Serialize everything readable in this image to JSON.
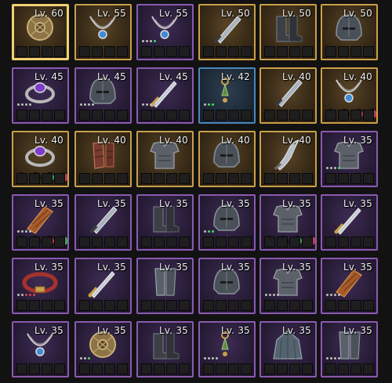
{
  "inventory": {
    "items": [
      {
        "icon": "shield-icon",
        "level": "Lv. 60",
        "rarity": "legendary",
        "selected": true,
        "dots": [],
        "gems": []
      },
      {
        "icon": "necklace-icon",
        "level": "Lv. 55",
        "rarity": "legendary",
        "dots": [],
        "gems": []
      },
      {
        "icon": "necklace-icon",
        "level": "Lv. 55",
        "rarity": "epic",
        "dots": [
          "white",
          "white",
          "white",
          "green"
        ],
        "gems": []
      },
      {
        "icon": "dagger-icon",
        "level": "Lv. 50",
        "rarity": "legendary",
        "dots": [],
        "gems": []
      },
      {
        "icon": "boots-icon",
        "level": "Lv. 50",
        "rarity": "legendary",
        "dots": [],
        "gems": []
      },
      {
        "icon": "helmet-icon",
        "level": "Lv. 50",
        "rarity": "legendary",
        "dots": [],
        "gems": []
      },
      {
        "icon": "ring-icon",
        "level": "Lv. 45",
        "rarity": "epic",
        "dots": [
          "white",
          "white",
          "white",
          "white"
        ],
        "gems": []
      },
      {
        "icon": "helmet-icon",
        "level": "Lv. 45",
        "rarity": "epic",
        "dots": [
          "white",
          "white",
          "white",
          "white"
        ],
        "gems": []
      },
      {
        "icon": "sword-icon",
        "level": "Lv. 45",
        "rarity": "epic",
        "dots": [
          "white",
          "white",
          "white",
          "white"
        ],
        "gems": []
      },
      {
        "icon": "earring-icon",
        "level": "Lv. 42",
        "rarity": "rare",
        "dots": [
          "white",
          "green",
          "green"
        ],
        "gems": []
      },
      {
        "icon": "dagger-icon",
        "level": "Lv. 40",
        "rarity": "legendary",
        "dots": [],
        "gems": []
      },
      {
        "icon": "necklace-icon",
        "level": "Lv. 40",
        "rarity": "legendary",
        "dots": [],
        "gems": [
          "red",
          "green",
          "red",
          "red"
        ]
      },
      {
        "icon": "ring-icon",
        "level": "Lv. 40",
        "rarity": "legendary",
        "dots": [],
        "gems": [
          "green",
          "red",
          "green",
          "red"
        ]
      },
      {
        "icon": "gauntlet-icon",
        "level": "Lv. 40",
        "rarity": "legendary",
        "dots": [],
        "gems": []
      },
      {
        "icon": "armor-icon",
        "level": "Lv. 40",
        "rarity": "legendary",
        "dots": [],
        "gems": []
      },
      {
        "icon": "helmet-icon",
        "level": "Lv. 40",
        "rarity": "legendary",
        "dots": [],
        "gems": []
      },
      {
        "icon": "scimitar-icon",
        "level": "Lv. 40",
        "rarity": "legendary",
        "dots": [],
        "gems": []
      },
      {
        "icon": "armor-icon",
        "level": "Lv. 35",
        "rarity": "epic",
        "dots": [
          "white",
          "white",
          "white",
          "green"
        ],
        "gems": []
      },
      {
        "icon": "bracer-icon",
        "level": "Lv. 35",
        "rarity": "epic",
        "dots": [
          "white",
          "white",
          "white",
          "white"
        ],
        "gems": [
          "green",
          "red",
          "red",
          "green"
        ]
      },
      {
        "icon": "dagger-icon",
        "level": "Lv. 35",
        "rarity": "epic",
        "dots": [],
        "gems": []
      },
      {
        "icon": "boots-icon",
        "level": "Lv. 35",
        "rarity": "epic",
        "dots": [],
        "gems": []
      },
      {
        "icon": "helmet-icon",
        "level": "Lv. 35",
        "rarity": "epic",
        "dots": [
          "white",
          "green",
          "green"
        ],
        "gems": []
      },
      {
        "icon": "armor-icon",
        "level": "Lv. 35",
        "rarity": "epic",
        "dots": [],
        "gems": [
          "green",
          "red",
          "green",
          "red"
        ]
      },
      {
        "icon": "sword-icon",
        "level": "Lv. 35",
        "rarity": "epic",
        "dots": [],
        "gems": []
      },
      {
        "icon": "belt-icon",
        "level": "Lv. 35",
        "rarity": "epic",
        "dots": [
          "white",
          "white",
          "red",
          "red",
          "red"
        ],
        "gems": []
      },
      {
        "icon": "sword-icon",
        "level": "Lv. 35",
        "rarity": "epic",
        "dots": [],
        "gems": []
      },
      {
        "icon": "greaves-icon",
        "level": "Lv. 35",
        "rarity": "epic",
        "dots": [],
        "gems": []
      },
      {
        "icon": "helmet-icon",
        "level": "Lv. 35",
        "rarity": "epic",
        "dots": [],
        "gems": []
      },
      {
        "icon": "armor-icon",
        "level": "Lv. 35",
        "rarity": "epic",
        "dots": [
          "white",
          "white",
          "white",
          "white"
        ],
        "gems": []
      },
      {
        "icon": "bracer-icon",
        "level": "Lv. 35",
        "rarity": "epic",
        "dots": [
          "white",
          "white",
          "white",
          "white"
        ],
        "gems": []
      },
      {
        "icon": "necklace-icon",
        "level": "Lv. 35",
        "rarity": "epic",
        "dots": [],
        "gems": []
      },
      {
        "icon": "shield-icon",
        "level": "Lv. 35",
        "rarity": "epic",
        "dots": [
          "white",
          "white",
          "green"
        ],
        "gems": []
      },
      {
        "icon": "boots-icon",
        "level": "Lv. 35",
        "rarity": "epic",
        "dots": [],
        "gems": []
      },
      {
        "icon": "earring-icon",
        "level": "Lv. 35",
        "rarity": "epic",
        "dots": [
          "white",
          "white",
          "white",
          "white"
        ],
        "gems": []
      },
      {
        "icon": "cloak-icon",
        "level": "Lv. 35",
        "rarity": "epic",
        "dots": [],
        "gems": []
      },
      {
        "icon": "greaves-icon",
        "level": "Lv. 35",
        "rarity": "epic",
        "dots": [
          "white",
          "white",
          "white",
          "white"
        ],
        "gems": []
      }
    ]
  }
}
